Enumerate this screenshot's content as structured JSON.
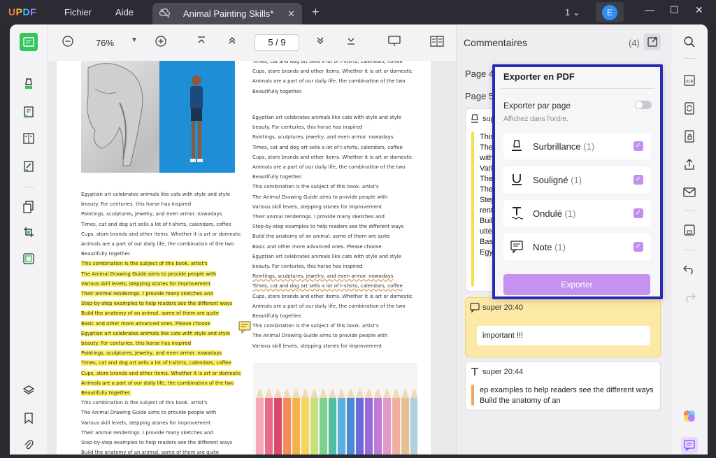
{
  "app": {
    "logo": "UPDF",
    "menu": [
      "Fichier",
      "Aide"
    ],
    "tab_title": "Animal Painting Skills*",
    "window_count": "1",
    "avatar_letter": "E"
  },
  "toolbar": {
    "zoom": "76%",
    "page_indicator": "5 / 9"
  },
  "document": {
    "left_column_plain": [
      "Egyptian art celebrates animals like cats with style and style",
      "beauty. For centuries, this horse has inspired",
      "Paintings, sculptures, jewelry, and even armor. nowadays",
      "Times, cat and dog art sells a lot of t-shirts, calendars, coffee",
      "Cups, store brands and other items. Whether it is art or domestic",
      "Animals are a part of our daily life, the combination of the two",
      "Beautifully together."
    ],
    "left_column_highlighted": [
      "This combination is the subject of this book. artist's",
      "The Animal Drawing Guide aims to provide people with",
      "Various skill levels, stepping stones for improvement",
      "Their animal renderings. I provide many sketches and",
      "Step-by-step examples to help readers see the different ways",
      "Build the anatomy of an animal. some of them are quite",
      "Basic and other more advanced ones. Please choose",
      "Egyptian art celebrates animals like cats with style and style",
      "beauty. For centuries, this horse has inspired",
      "Paintings, sculptures, jewelry, and even armor. nowadays",
      "Times, cat and dog art sells a lot of t-shirts, calendars, coffee",
      "Cups, store brands and other items. Whether it is art or domestic",
      "Animals are a part of our daily life, the combination of the two",
      "Beautifully together."
    ],
    "left_column_tail": [
      "This combination is the subject of this book. artist's",
      "The Animal Drawing Guide aims to provide people with",
      "Various skill levels, stepping stones for improvement",
      "Their animal renderings. I provide many sketches and",
      "Step-by-step examples to help readers see the different ways",
      "Build the anatomy of an animal. some of them are quite"
    ],
    "right_column_top": [
      "Times, cat and dog art sells a lot of t-shirts, calendars, coffee",
      "Cups, store brands and other items. Whether it is art or domestic",
      "Animals are a part of our daily life, the combination of the two",
      "Beautifully together."
    ],
    "right_column_main": [
      "Egyptian art celebrates animals like cats with style and style",
      "beauty. For centuries, this horse has inspired",
      "Paintings, sculptures, jewelry, and even armor. nowadays",
      "Times, cat and dog art sells a lot of t-shirts, calendars, coffee",
      "Cups, store brands and other items. Whether it is art or domestic",
      "Animals are a part of our daily life, the combination of the two",
      "Beautifully together.",
      "This combination is the subject of this book. artist's",
      "The Animal Drawing Guide aims to provide people with",
      "Various skill levels, stepping stones for improvement",
      "Their animal renderings. I provide many sketches and",
      "Step-by-step examples to help readers see the different ways",
      "Build the anatomy of an animal. some of them are quite",
      "Basic and other more advanced ones. Please choose",
      "Egyptian art celebrates animals like cats with style and style",
      "beauty. For centuries, this horse has inspired",
      "Paintings, sculptures, jewelry, and even armor. nowadays",
      "Times, cat and dog art sells a lot of t-shirts, calendars, coffee",
      "Cups, store brands and other items. Whether it is art or domestic",
      "Animals are a part of our daily life, the combination of the two",
      "Beautifully together.",
      "This combination is the subject of this book. artist's",
      "The Animal Drawing Guide aims to provide people with",
      "Various skill levels, stepping stones for improvement"
    ]
  },
  "comments": {
    "title": "Commentaires",
    "count": "(4)",
    "page4_label": "Page 4",
    "page5_label": "Page 5",
    "card1_author": "super",
    "card1_lines": [
      "This",
      "The",
      "with",
      "Vari",
      "Thei",
      "The",
      "Step",
      "rent",
      "Buil",
      "uite",
      "Basi",
      "Egy"
    ],
    "card2_author": "super 20:40",
    "card2_note": "important !!!",
    "card3_author": "super 20:44",
    "card3_lines": [
      "ep examples to help readers see the different ways",
      "Build the anatomy of an"
    ]
  },
  "export_popup": {
    "title": "Exporter en PDF",
    "per_page_label": "Exporter par page",
    "hint": "Affichez dans l'ordre.",
    "options": [
      {
        "label": "Surbrillance",
        "count": "(1)"
      },
      {
        "label": "Souligné",
        "count": "(1)"
      },
      {
        "label": "Ondulé",
        "count": "(1)"
      },
      {
        "label": "Note",
        "count": "(1)"
      }
    ],
    "button": "Exporter"
  },
  "colors": {
    "accent_green": "#34c759",
    "highlight_yellow": "#fdf25a",
    "checkbox_purple": "#c08ff2",
    "popup_border": "#2a2ab8"
  }
}
